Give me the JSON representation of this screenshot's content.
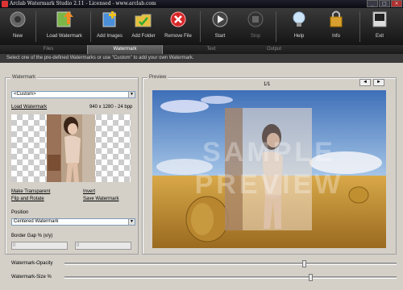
{
  "window": {
    "title": "Arclab Watermark Studio 2.11 - Licensed - www.arclab.com",
    "minimize": "_",
    "maximize": "□",
    "close": "×"
  },
  "toolbar": {
    "new": "New",
    "load_watermark": "Load Watermark",
    "add_images": "Add Images",
    "add_folder": "Add Folder",
    "remove_file": "Remove File",
    "start": "Start",
    "stop": "Stop",
    "help": "Help",
    "info": "Info",
    "exit": "Exit"
  },
  "tabs": [
    {
      "label": "Files",
      "active": false
    },
    {
      "label": "Watermark",
      "active": true
    },
    {
      "label": "Text",
      "active": false
    },
    {
      "label": "Output",
      "active": false
    }
  ],
  "hint": "Select one of the pre-defined Watermarks or use \"Custom\" to add your own Watermark.",
  "watermark_panel": {
    "title": "Watermark",
    "preset_value": "<Custom>",
    "load_link": "Load Watermark",
    "dimensions": "940 x 1280 - 24 bpp",
    "make_transparent": "Make Transparent",
    "invert": "Invert",
    "flip_rotate": "Flip and Rotate",
    "save_watermark": "Save Watermark",
    "position_label": "Position",
    "position_value": "Centered Watermark",
    "border_gap_label": "Border Gap % (x/y)",
    "border_gap_x": "0",
    "border_gap_y": "0"
  },
  "preview_panel": {
    "title": "Preview",
    "counter": "1/1",
    "prev": "◄",
    "next": "►",
    "watermark_text": "SAMPLE PREVIEW"
  },
  "sliders": {
    "opacity_label": "Watermark-Opacity",
    "size_label": "Watermark-Size %",
    "opacity_value": 0.72,
    "size_value": 0.74
  },
  "colors": {
    "sky": "#4a7dc4",
    "field": "#c89a3a",
    "toolbar": "#2a2a2a"
  }
}
